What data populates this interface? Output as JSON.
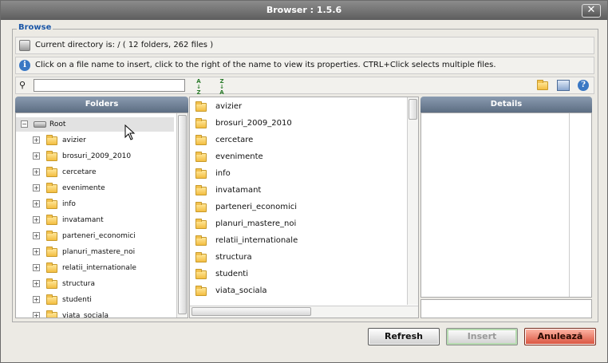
{
  "window": {
    "title": "Browser : 1.5.6",
    "close_label": "✕"
  },
  "fieldset": {
    "legend": "Browse"
  },
  "status": {
    "directory": "Current directory is: / ( 12 folders, 262 files )",
    "hint": "Click on a file name to insert, click to the right of the name to view its properties. CTRL+Click selects multiple files."
  },
  "search": {
    "value": "",
    "placeholder": ""
  },
  "panes": {
    "folders_title": "Folders",
    "details_title": "Details"
  },
  "tree": {
    "root": "Root",
    "items": [
      "avizier",
      "brosuri_2009_2010",
      "cercetare",
      "evenimente",
      "info",
      "invatamant",
      "parteneri_economici",
      "planuri_mastere_noi",
      "relatii_internationale",
      "structura",
      "studenti",
      "viata_sociala"
    ]
  },
  "files": {
    "items": [
      "avizier",
      "brosuri_2009_2010",
      "cercetare",
      "evenimente",
      "info",
      "invatamant",
      "parteneri_economici",
      "planuri_mastere_noi",
      "relatii_internationale",
      "structura",
      "studenti",
      "viata_sociala"
    ]
  },
  "buttons": {
    "refresh": "Refresh",
    "insert": "Insert",
    "cancel": "Anulează"
  },
  "colors": {
    "accent": "#1c57a7",
    "header": "#5c6d82",
    "cancel": "#d8513c"
  }
}
